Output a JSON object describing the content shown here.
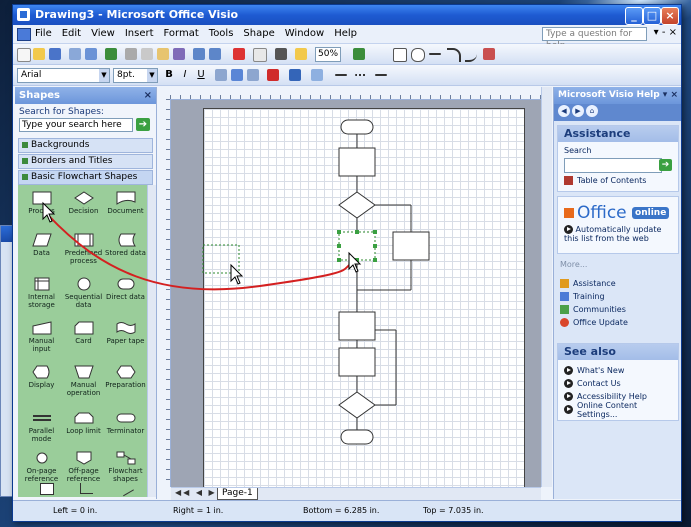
{
  "window": {
    "title": "Drawing3 - Microsoft Office Visio"
  },
  "menu": {
    "items": [
      "File",
      "Edit",
      "View",
      "Insert",
      "Format",
      "Tools",
      "Shape",
      "Window",
      "Help"
    ],
    "question_placeholder": "Type a question for help"
  },
  "toolbar": {
    "font": "Arial",
    "font_size": "8pt.",
    "zoom": "50%"
  },
  "shapes_panel": {
    "title": "Shapes",
    "search_label": "Search for Shapes:",
    "search_placeholder": "Type your search here",
    "stencils": [
      "Backgrounds",
      "Borders and Titles",
      "Basic Flowchart Shapes"
    ],
    "shapes": [
      {
        "label": "Process",
        "icon": "process-shape-icon"
      },
      {
        "label": "Decision",
        "icon": "decision-shape-icon"
      },
      {
        "label": "Document",
        "icon": "document-shape-icon"
      },
      {
        "label": "Data",
        "icon": "data-shape-icon"
      },
      {
        "label": "Predefined process",
        "icon": "predefined-process-shape-icon"
      },
      {
        "label": "Stored data",
        "icon": "stored-data-shape-icon"
      },
      {
        "label": "Internal storage",
        "icon": "internal-storage-shape-icon"
      },
      {
        "label": "Sequential data",
        "icon": "sequential-data-shape-icon"
      },
      {
        "label": "Direct data",
        "icon": "direct-data-shape-icon"
      },
      {
        "label": "Manual input",
        "icon": "manual-input-shape-icon"
      },
      {
        "label": "Card",
        "icon": "card-shape-icon"
      },
      {
        "label": "Paper tape",
        "icon": "paper-tape-shape-icon"
      },
      {
        "label": "Display",
        "icon": "display-shape-icon"
      },
      {
        "label": "Manual operation",
        "icon": "manual-operation-shape-icon"
      },
      {
        "label": "Preparation",
        "icon": "preparation-shape-icon"
      },
      {
        "label": "Parallel mode",
        "icon": "parallel-mode-shape-icon"
      },
      {
        "label": "Loop limit",
        "icon": "loop-limit-shape-icon"
      },
      {
        "label": "Terminator",
        "icon": "terminator-shape-icon"
      },
      {
        "label": "On-page reference",
        "icon": "on-page-reference-shape-icon"
      },
      {
        "label": "Off-page reference",
        "icon": "off-page-reference-shape-icon"
      },
      {
        "label": "Flowchart shapes",
        "icon": "flowchart-shapes-icon"
      }
    ]
  },
  "drawing": {
    "page_tab": "Page-1"
  },
  "help_pane": {
    "title": "Microsoft Visio Help",
    "assistance_title": "Assistance",
    "search_label": "Search",
    "toc_label": "Table of Contents",
    "office_word": "Office",
    "office_tag": "online",
    "auto_update": "Automatically update this list from the web",
    "more": "More...",
    "links": [
      "Assistance",
      "Training",
      "Communities",
      "Office Update"
    ],
    "see_also_title": "See also",
    "see_also": [
      "What's New",
      "Contact Us",
      "Accessibility Help",
      "Online Content Settings..."
    ]
  },
  "status": {
    "left": "Left = 0 in.",
    "right": "Right = 1 in.",
    "bottom": "Bottom = 6.285 in.",
    "top": "Top = 7.035 in."
  }
}
